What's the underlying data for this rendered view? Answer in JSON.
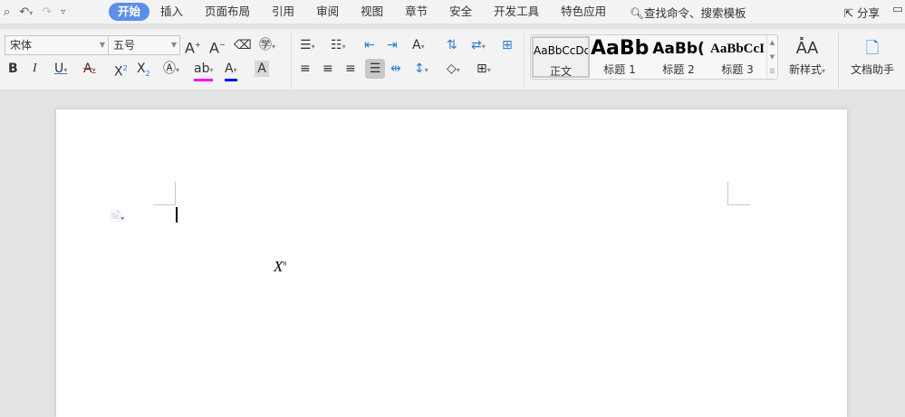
{
  "menubar": {
    "quick_access": [
      "print-preview",
      "undo",
      "redo",
      "customize"
    ],
    "tabs": [
      "开始",
      "插入",
      "页面布局",
      "引用",
      "审阅",
      "视图",
      "章节",
      "安全",
      "开发工具",
      "特色应用"
    ],
    "active_tab": "开始",
    "search": "查找命令、搜索模板",
    "share": "分享"
  },
  "font": {
    "name": "宋体",
    "size": "五号"
  },
  "styles": [
    {
      "preview": "AaBbCcDd",
      "name": "正文"
    },
    {
      "preview": "AaBb",
      "name": "标题 1"
    },
    {
      "preview": "AaBb(",
      "name": "标题 2"
    },
    {
      "preview": "AaBbCcI",
      "name": "标题 3"
    }
  ],
  "new_style": "新样式",
  "doc_helper": "文档助手",
  "document": {
    "formula_base": "X",
    "formula_sup": "n"
  },
  "colors": {
    "accent": "#5b8fe8",
    "highlight": "#ff00ff",
    "font_color": "#0000ff"
  }
}
